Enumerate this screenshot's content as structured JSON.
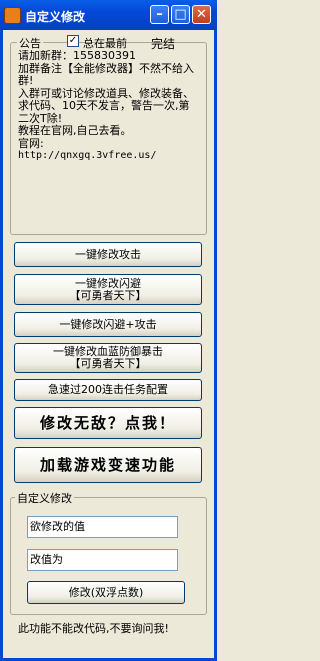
{
  "window": {
    "title": "自定义修改",
    "minimize_symbol": "–",
    "maximize_symbol": "□",
    "close_symbol": "✕"
  },
  "notice_group": {
    "label": "公告",
    "checkbox_label": "总在最前",
    "checkbox_checked": true,
    "check_mark": "✓",
    "done_label": "完结",
    "lines": [
      "请加新群：155830391",
      "加群备注【全能修改器】不然不给入群!",
      "入群可或讨论修改道具、修改装备、求代码、10天不发言，警告一次,第二次T除!",
      "教程在官网,自己去看。",
      "官网:"
    ],
    "url": "http://qnxgq.3vfree.us/"
  },
  "buttons": {
    "attack": "一键修改攻击",
    "dodge_line1": "一键修改闪避",
    "dodge_line2": "【可勇者天下】",
    "dodge_attack": "一键修改闪避+攻击",
    "hp_line1": "一键修改血蓝防御暴击",
    "hp_line2": "【可勇者天下】",
    "combo": "急速过200连击任务配置",
    "invincible": "修改无敌？点我！",
    "speed": "加载游戏变速功能"
  },
  "custom_group": {
    "label": "自定义修改",
    "value_placeholder": "欲修改的值",
    "newvalue_placeholder": "改值为",
    "modify_button": "修改(双浮点数)",
    "note": "此功能不能改代码,不要询问我!"
  }
}
